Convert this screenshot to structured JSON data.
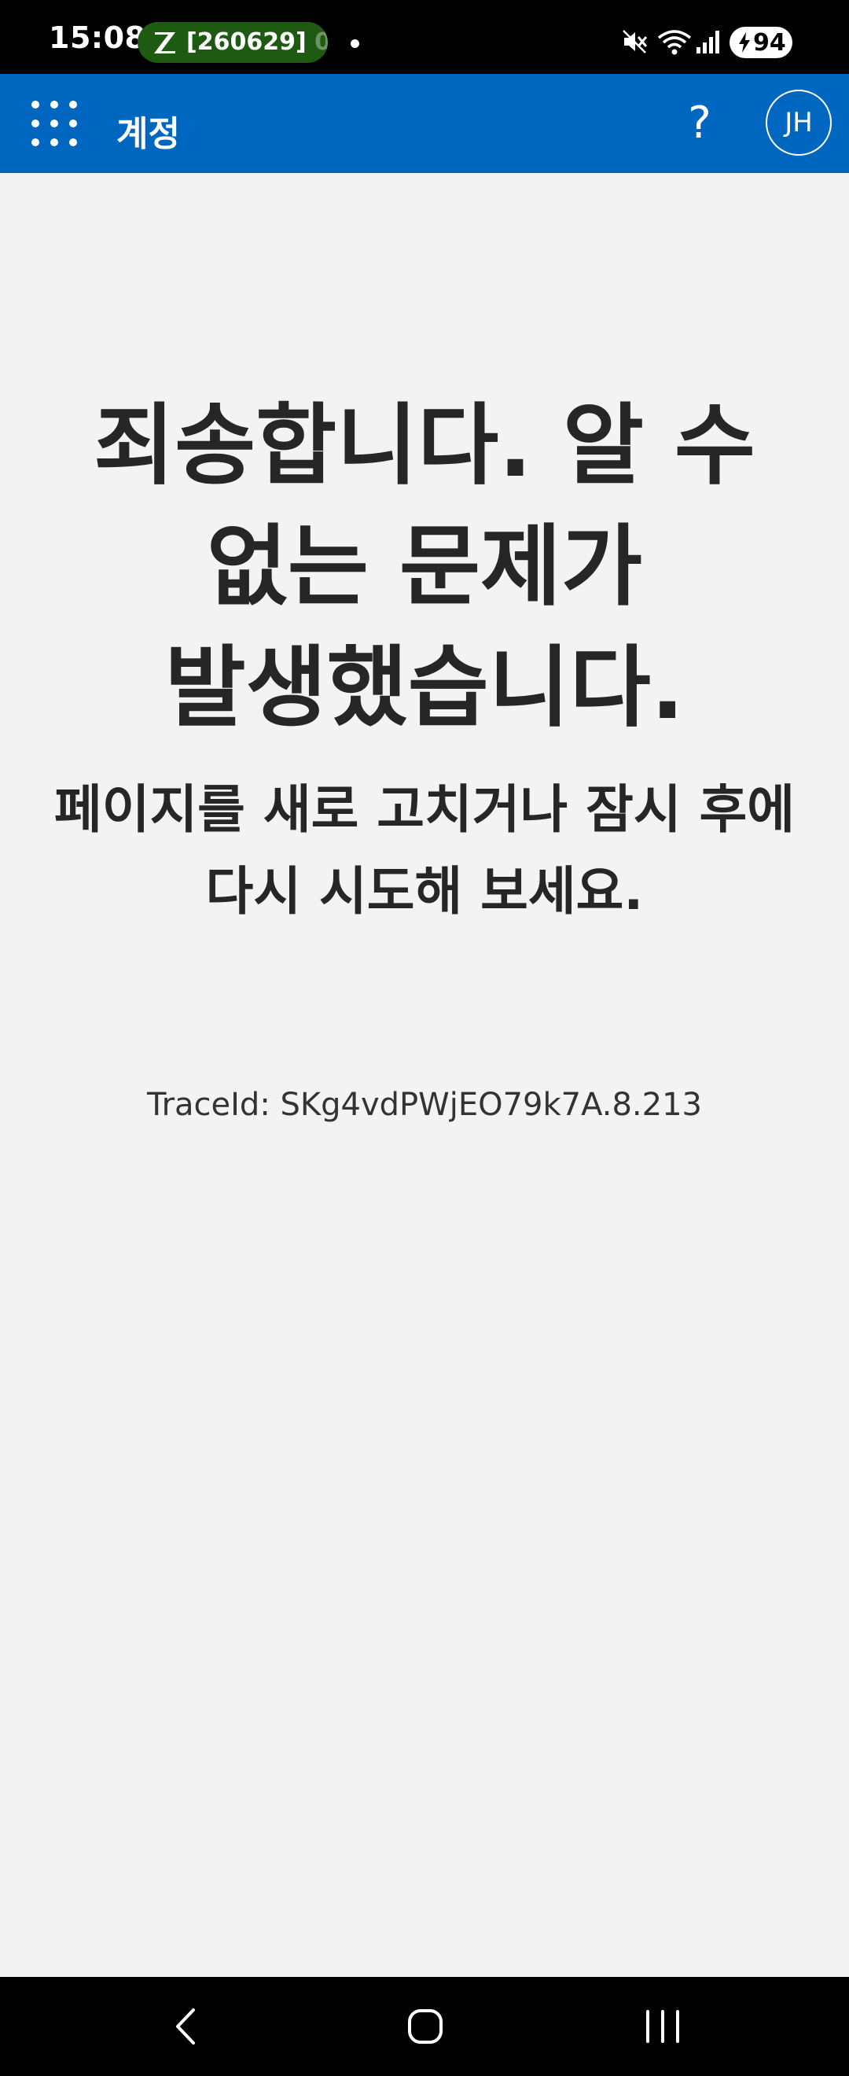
{
  "status_bar": {
    "time": "15:08",
    "notification_text": "[260629]",
    "notification_overflow": "0",
    "battery_level": "94"
  },
  "header": {
    "title": "계정",
    "help_label": "?",
    "avatar_initials": "JH",
    "background_color": "#0067c0"
  },
  "main": {
    "title": "죄송합니다. 알 수 없는 문제가 발생했습니다.",
    "subtitle": "페이지를 새로 고치거나 잠시 후에 다시 시도해 보세요.",
    "trace_id": "TraceId: SKg4vdPWjEO79k7A.8.213"
  },
  "icons": {
    "waffle": "app-launcher-waffle-icon",
    "help": "help-question-icon",
    "mute": "vibrate-mute-icon",
    "wifi": "wifi-icon",
    "signal": "cell-signal-icon",
    "battery": "battery-charging-icon",
    "back": "nav-back-icon",
    "home": "nav-home-icon",
    "recent": "nav-recent-apps-icon"
  }
}
